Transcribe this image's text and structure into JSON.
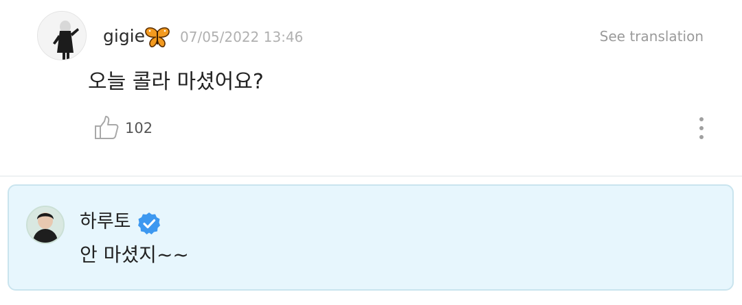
{
  "post": {
    "author": {
      "name": "gigie",
      "badge_icon": "butterfly-icon",
      "avatar": "avatar-gigie"
    },
    "timestamp": "07/05/2022 13:46",
    "translate_label": "See translation",
    "message": "오늘 콜라 마셨어요?",
    "likes": "102",
    "like_icon": "thumbs-up-icon",
    "menu_icon": "more-vertical-icon"
  },
  "reply": {
    "author": {
      "name": "하루토",
      "verified": true,
      "verified_icon": "verified-badge-icon",
      "avatar": "avatar-haruto"
    },
    "message": "안 마셨지~~"
  },
  "colors": {
    "reply_background": "#e7f6fd",
    "reply_border": "#c9e4ee",
    "verified_blue": "#3d98f0",
    "butterfly_orange": "#f39a1f"
  }
}
